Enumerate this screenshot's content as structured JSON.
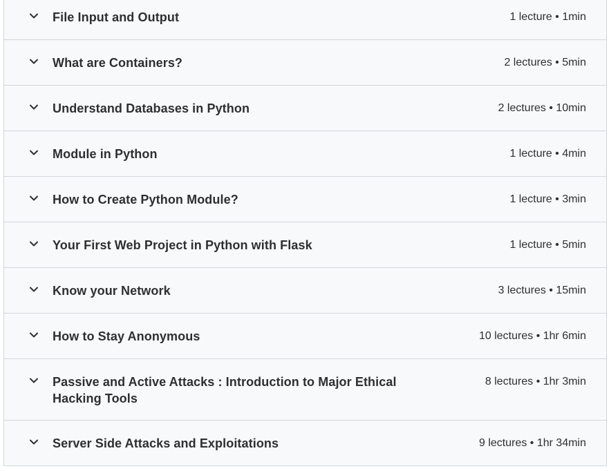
{
  "sections": [
    {
      "title": "File Input and Output",
      "meta": "1 lecture • 1min"
    },
    {
      "title": "What are Containers?",
      "meta": "2 lectures • 5min"
    },
    {
      "title": "Understand Databases in Python",
      "meta": "2 lectures • 10min"
    },
    {
      "title": "Module in Python",
      "meta": "1 lecture • 4min"
    },
    {
      "title": "How to Create Python Module?",
      "meta": "1 lecture • 3min"
    },
    {
      "title": "Your First Web Project in Python with Flask",
      "meta": "1 lecture • 5min"
    },
    {
      "title": "Know your Network",
      "meta": "3 lectures • 15min"
    },
    {
      "title": "How to Stay Anonymous",
      "meta": "10 lectures • 1hr 6min"
    },
    {
      "title": "Passive and Active Attacks : Introduction to Major Ethical Hacking Tools",
      "meta": "8 lectures • 1hr 3min"
    },
    {
      "title": "Server Side Attacks and Exploitations",
      "meta": "9 lectures • 1hr 34min"
    }
  ],
  "icons": {
    "expand": "chevron-down-icon"
  },
  "colors": {
    "section_bg": "#f7f9fa",
    "border": "#d1d7dc",
    "text": "#2d2f31"
  }
}
